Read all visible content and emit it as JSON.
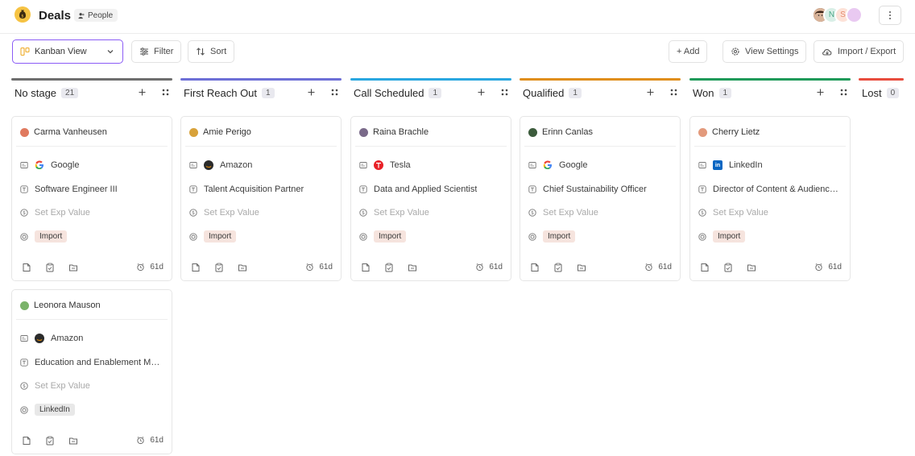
{
  "app": {
    "title": "Deals",
    "object_badge": "People"
  },
  "header": {
    "avatars": [
      {
        "kind": "photo",
        "color": "#6b4a3a"
      },
      {
        "kind": "letter",
        "letter": "N",
        "color": "#d9efe7",
        "text_color": "#4aa585"
      },
      {
        "kind": "letter",
        "letter": "S",
        "color": "#fde2d8",
        "text_color": "#e58b6f"
      },
      {
        "kind": "letter",
        "letter": "",
        "color": "#e9c9f1",
        "text_color": "#b266c8"
      }
    ]
  },
  "toolbar": {
    "view_label": "Kanban View",
    "filter_label": "Filter",
    "sort_label": "Sort",
    "add_label": "+ Add",
    "view_settings_label": "View Settings",
    "import_export_label": "Import / Export"
  },
  "columns": [
    {
      "name": "No stage",
      "count": "21",
      "color": "#6e6e6e"
    },
    {
      "name": "First Reach Out",
      "count": "1",
      "color": "#6d6fd6"
    },
    {
      "name": "Call Scheduled",
      "count": "1",
      "color": "#2aa7e0"
    },
    {
      "name": "Qualified",
      "count": "1",
      "color": "#e08e1c"
    },
    {
      "name": "Won",
      "count": "1",
      "color": "#1f9a5a"
    },
    {
      "name": "Lost",
      "count": "0",
      "color": "#e84c3d"
    }
  ],
  "cards": [
    {
      "person": "Carma Vanheusen",
      "avatar_color": "#e07a5f",
      "company": "Google",
      "company_logo": "google",
      "job_title": "Software Engineer III",
      "exp_value_placeholder": "Set Exp Value",
      "source": "Import",
      "age": "61d"
    },
    {
      "person": "Amie Perigo",
      "avatar_color": "#d8a23a",
      "company": "Amazon",
      "company_logo": "amazon",
      "job_title": "Talent Acquisition Partner",
      "exp_value_placeholder": "Set Exp Value",
      "source": "Import",
      "age": "61d"
    },
    {
      "person": "Raina Brachle",
      "avatar_color": "#7a6a8a",
      "company": "Tesla",
      "company_logo": "tesla",
      "job_title": "Data and Applied Scientist",
      "exp_value_placeholder": "Set Exp Value",
      "source": "Import",
      "age": "61d"
    },
    {
      "person": "Erinn Canlas",
      "avatar_color": "#3c5c3c",
      "company": "Google",
      "company_logo": "google",
      "job_title": "Chief Sustainability Officer",
      "exp_value_placeholder": "Set Exp Value",
      "source": "Import",
      "age": "61d"
    },
    {
      "person": "Cherry Lietz",
      "avatar_color": "#e39a7c",
      "company": "LinkedIn",
      "company_logo": "linkedin",
      "job_title": "Director of Content & Audience Development",
      "exp_value_placeholder": "Set Exp Value",
      "source": "Import",
      "age": "61d"
    },
    {
      "person": "Leonora Mauson",
      "avatar_color": "#7bb36a",
      "company": "Amazon",
      "company_logo": "amazon",
      "job_title": "Education and Enablement Manager",
      "exp_value_placeholder": "Set Exp Value",
      "source": "LinkedIn",
      "age": "61d"
    }
  ]
}
